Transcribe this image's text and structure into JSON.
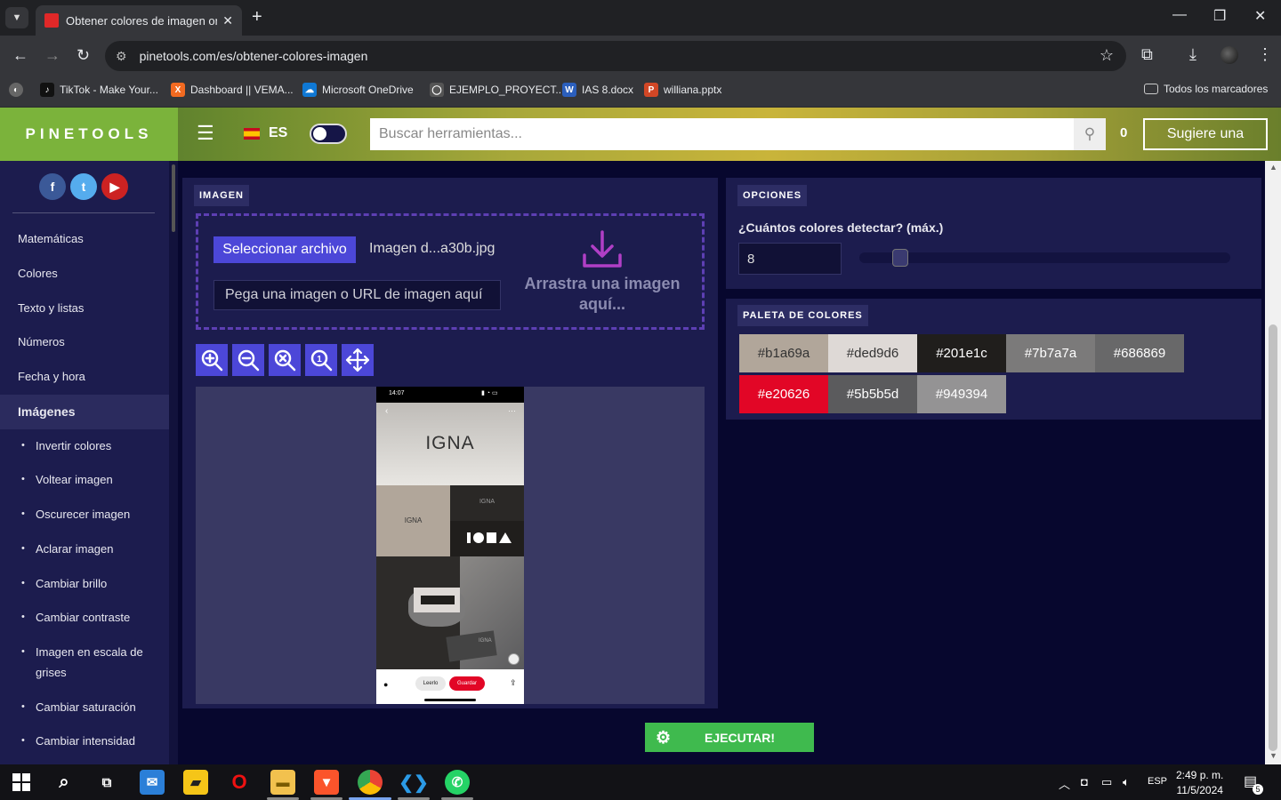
{
  "browser": {
    "tab_title": "Obtener colores de imagen online",
    "url": "pinetools.com/es/obtener-colores-imagen",
    "bookmarks": [
      {
        "label": "TikTok - Make Your...",
        "color": "#111111",
        "icon": "tiktok-icon"
      },
      {
        "label": "Dashboard || VEMA...",
        "color": "#f26a21",
        "icon": "xampp-icon"
      },
      {
        "label": "Microsoft OneDrive",
        "color": "#0f78d4",
        "icon": "onedrive-icon"
      },
      {
        "label": "EJEMPLO_PROYECT...",
        "color": "#555555",
        "icon": "globe-icon"
      },
      {
        "label": "IAS 8.docx",
        "color": "#2b5fbd",
        "icon": "word-icon"
      },
      {
        "label": "williana.pptx",
        "color": "#d24726",
        "icon": "powerpoint-icon"
      }
    ],
    "all_bookmarks": "Todos los marcadores"
  },
  "header": {
    "logo": "PINETOOLS",
    "lang": "ES",
    "search_placeholder": "Buscar herramientas...",
    "counter": "0",
    "suggest": "Sugiere una"
  },
  "sidebar": {
    "social": [
      {
        "name": "facebook",
        "glyph": "f",
        "color": "#3b5998"
      },
      {
        "name": "twitter",
        "glyph": "t",
        "color": "#55acee"
      },
      {
        "name": "youtube",
        "glyph": "▶",
        "color": "#cc2222"
      }
    ],
    "categories": [
      "Matemáticas",
      "Colores",
      "Texto y listas",
      "Números",
      "Fecha y hora"
    ],
    "active_category": "Imágenes",
    "subitems": [
      "Invertir colores",
      "Voltear imagen",
      "Oscurecer imagen",
      "Aclarar imagen",
      "Cambiar brillo",
      "Cambiar contraste",
      "Imagen en escala de grises",
      "Cambiar saturación",
      "Cambiar intensidad"
    ]
  },
  "image_panel": {
    "label": "IMAGEN",
    "select_button": "Seleccionar archivo",
    "file_name": "Imagen d...a30b.jpg",
    "paste_placeholder": "Pega una imagen o URL de imagen aquí",
    "drop_text": "Arrastra una imagen aquí..."
  },
  "phone_preview": {
    "time": "14:07",
    "brand": "IGNA",
    "btn_open": "Leerlo",
    "btn_save": "Guardar"
  },
  "options_panel": {
    "label": "OPCIONES",
    "question": "¿Cuántos colores detectar? (máx.)",
    "count": "8",
    "slider_fraction": 0.11
  },
  "palette_panel": {
    "label": "PALETA DE COLORES",
    "colors": [
      {
        "hex": "#b1a69a",
        "text_color": "#333333"
      },
      {
        "hex": "#ded9d6",
        "text_color": "#333333"
      },
      {
        "hex": "#201e1c",
        "text_color": "#ffffff"
      },
      {
        "hex": "#7b7a7a",
        "text_color": "#ffffff"
      },
      {
        "hex": "#686869",
        "text_color": "#ffffff"
      },
      {
        "hex": "#e20626",
        "text_color": "#ffffff"
      },
      {
        "hex": "#5b5b5d",
        "text_color": "#ffffff"
      },
      {
        "hex": "#949394",
        "text_color": "#ffffff"
      }
    ]
  },
  "run_button": "EJECUTAR!",
  "taskbar": {
    "lang": "ESP",
    "time": "2:49 p. m.",
    "date": "11/5/2024",
    "notifications": "5"
  }
}
